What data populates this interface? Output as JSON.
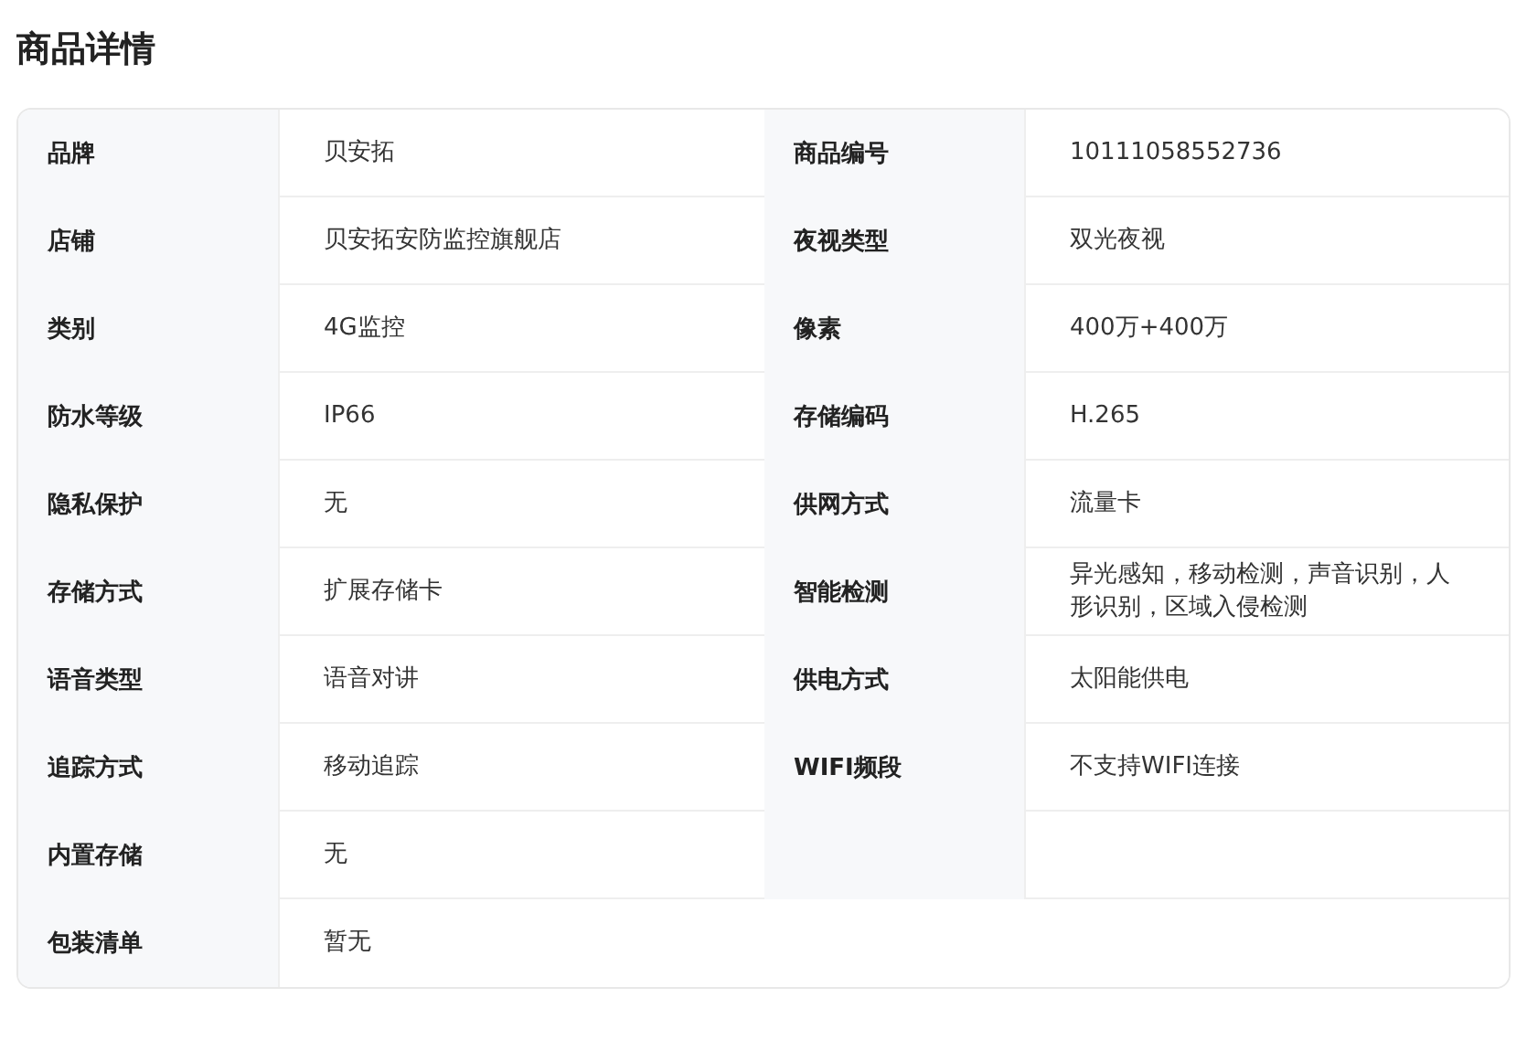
{
  "title": "商品详情",
  "rows": [
    {
      "kind": "pair",
      "fields": [
        {
          "label": "品牌",
          "value": "贝安拓"
        },
        {
          "label": "商品编号",
          "value": "10111058552736"
        }
      ]
    },
    {
      "kind": "pair",
      "fields": [
        {
          "label": "店铺",
          "value": "贝安拓安防监控旗舰店"
        },
        {
          "label": "夜视类型",
          "value": "双光夜视"
        }
      ]
    },
    {
      "kind": "pair",
      "fields": [
        {
          "label": "类别",
          "value": "4G监控"
        },
        {
          "label": "像素",
          "value": "400万+400万"
        }
      ]
    },
    {
      "kind": "pair",
      "fields": [
        {
          "label": "防水等级",
          "value": "IP66"
        },
        {
          "label": "存储编码",
          "value": "H.265"
        }
      ]
    },
    {
      "kind": "pair",
      "fields": [
        {
          "label": "隐私保护",
          "value": "无"
        },
        {
          "label": "供网方式",
          "value": "流量卡"
        }
      ]
    },
    {
      "kind": "pair",
      "fields": [
        {
          "label": "存储方式",
          "value": "扩展存储卡"
        },
        {
          "label": "智能检测",
          "value": "异光感知，移动检测，声音识别，人形识别，区域入侵检测"
        }
      ]
    },
    {
      "kind": "pair",
      "fields": [
        {
          "label": "语音类型",
          "value": "语音对讲"
        },
        {
          "label": "供电方式",
          "value": "太阳能供电"
        }
      ]
    },
    {
      "kind": "pair",
      "fields": [
        {
          "label": "追踪方式",
          "value": "移动追踪"
        },
        {
          "label": "WIFI频段",
          "value": "不支持WIFI连接"
        }
      ]
    },
    {
      "kind": "pair",
      "fields": [
        {
          "label": "内置存储",
          "value": "无"
        }
      ]
    },
    {
      "kind": "full",
      "fields": [
        {
          "label": "包装清单",
          "value": "暂无"
        }
      ]
    }
  ]
}
